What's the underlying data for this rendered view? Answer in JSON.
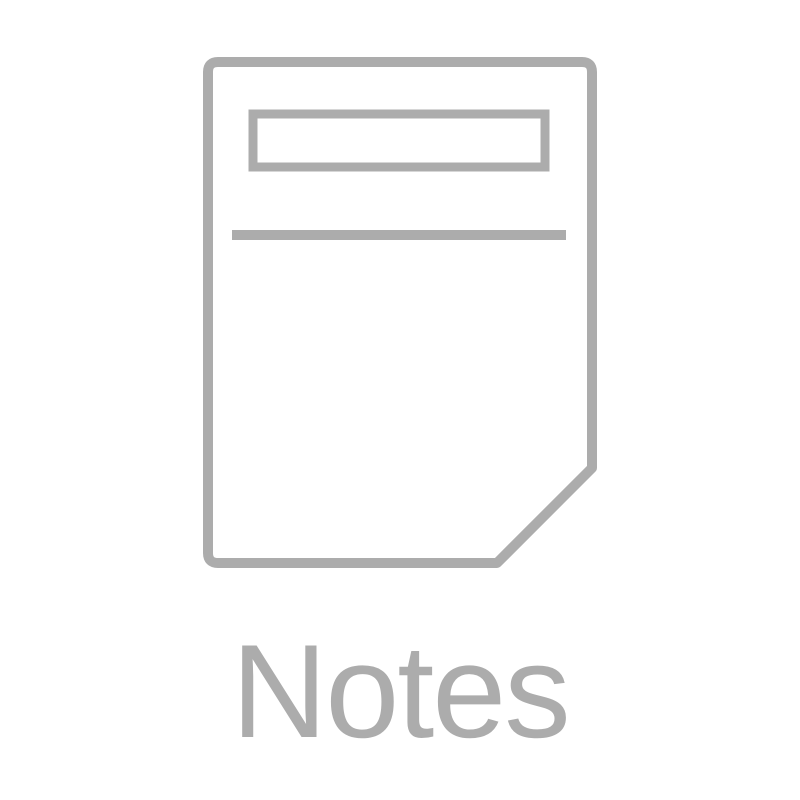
{
  "app": {
    "label": "Notes",
    "icon": "notes-document-icon",
    "color": "#acacac",
    "background": "#ffffff"
  }
}
